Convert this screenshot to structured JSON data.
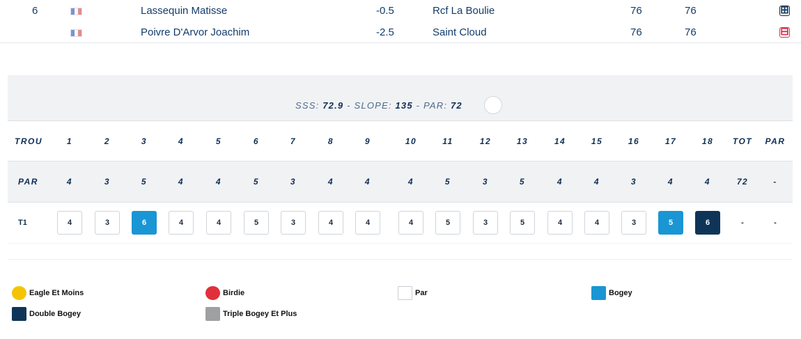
{
  "players": [
    {
      "rank": "6",
      "name": "Lassequin Matisse",
      "handicap": "-0.5",
      "club": "Rcf La Boulie",
      "score1": "76",
      "score2": "76",
      "toggle": "⊞",
      "toggle_icon": "plus-square-icon"
    },
    {
      "rank": "",
      "name": "Poivre D'Arvor Joachim",
      "handicap": "-2.5",
      "club": "Saint Cloud",
      "score1": "76",
      "score2": "76",
      "toggle": "⊟",
      "toggle_icon": "minus-square-icon"
    }
  ],
  "course": {
    "sss_label": "SSS:",
    "sss": "72.9",
    "slope_label": "SLOPE:",
    "slope": "135",
    "par_label": "PAR:",
    "par": "72",
    "sep": "-"
  },
  "scorecard": {
    "hole_label": "TROU",
    "holes": [
      "1",
      "2",
      "3",
      "4",
      "5",
      "6",
      "7",
      "8",
      "9",
      "10",
      "11",
      "12",
      "13",
      "14",
      "15",
      "16",
      "17",
      "18"
    ],
    "tot_label": "TOT",
    "par_col_label": "PAR",
    "par_label": "PAR",
    "pars": [
      "4",
      "3",
      "5",
      "4",
      "4",
      "5",
      "3",
      "4",
      "4",
      "4",
      "5",
      "3",
      "5",
      "4",
      "4",
      "3",
      "4",
      "4"
    ],
    "par_total": "72",
    "par_extra": "-",
    "tee_label": "T1",
    "scores": [
      "4",
      "3",
      "6",
      "4",
      "4",
      "5",
      "3",
      "4",
      "4",
      "4",
      "5",
      "3",
      "5",
      "4",
      "4",
      "3",
      "5",
      "6"
    ],
    "score_types": [
      "par",
      "par",
      "bogey",
      "par",
      "par",
      "par",
      "par",
      "par",
      "par",
      "par",
      "par",
      "par",
      "par",
      "par",
      "par",
      "par",
      "bogey",
      "dbogey"
    ],
    "tee_total": "-",
    "tee_par": "-"
  },
  "legend": [
    {
      "label": "Eagle Et Moins",
      "color": "#f5c400",
      "shape": "circle"
    },
    {
      "label": "Birdie",
      "color": "#e0303c",
      "shape": "circle"
    },
    {
      "label": "Par",
      "color": "#ffffff",
      "shape": "square"
    },
    {
      "label": "Bogey",
      "color": "#1a96d4",
      "shape": "square"
    },
    {
      "label": "Double Bogey",
      "color": "#0e3558",
      "shape": "square"
    },
    {
      "label": "Triple Bogey Et Plus",
      "color": "#9ea0a2",
      "shape": "square"
    }
  ]
}
